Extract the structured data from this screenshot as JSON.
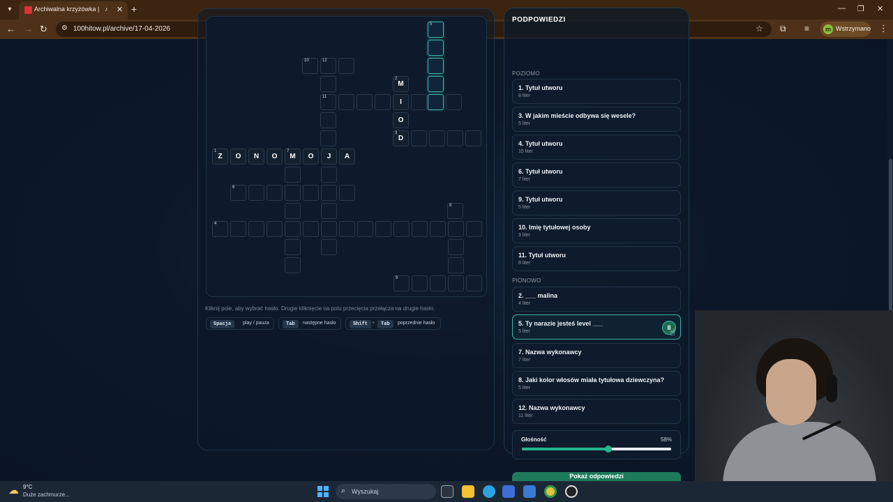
{
  "browser": {
    "tab_title": "Archiwalna krzyżówka | 100",
    "tab_audio_icon": "speaker-icon",
    "url": "100hitow.pl/archive/17-04-2026",
    "profile_initial": "m",
    "profile_label": "Wstrzymano"
  },
  "crossword": {
    "letters": {
      "r2c9": "M",
      "r3c9": "I",
      "r4c9": "O",
      "r5c9": "D",
      "r6c0": "Z",
      "r6c1": "O",
      "r6c2": "N",
      "r6c3": "O",
      "r6c4": "M",
      "r6c5": "O",
      "r6c6": "J",
      "r6c7": "A"
    },
    "numbers": {
      "n1": "1",
      "n2": "2",
      "n3": "3",
      "n4": "4",
      "n5": "5",
      "n6": "6",
      "n7": "7",
      "n8": "8",
      "n9": "9",
      "n10": "10",
      "n11": "11",
      "n12": "12"
    },
    "instructions": "Kliknij pole, aby wybrać hasło. Drugie kliknięcie na polu przecięcia przełącza na drugie hasło.",
    "shortcuts": {
      "space_key": "Spacja",
      "space_desc": "play / pauza",
      "tab_key": "Tab",
      "tab_desc": "następne hasło",
      "shift_key": "Shift",
      "plus": "+",
      "shift_tab_key": "Tab",
      "shift_tab_desc": "poprzednie hasło"
    }
  },
  "clues": {
    "title": "PODPOWIEDZI",
    "across_label": "POZIOMO",
    "down_label": "PIONOWO",
    "across": [
      {
        "text": "1. Tytuł utworu",
        "len": "8 liter"
      },
      {
        "text": "3. W jakim mieście odbywa się wesele?",
        "len": "5 liter"
      },
      {
        "text": "4. Tytuł utworu",
        "len": "15 liter"
      },
      {
        "text": "6. Tytuł utworu",
        "len": "7 liter"
      },
      {
        "text": "9. Tytuł utworu",
        "len": "5 liter"
      },
      {
        "text": "10. Imię tytułowej osoby",
        "len": "3 liter"
      },
      {
        "text": "11. Tytuł utworu",
        "len": "8 liter"
      }
    ],
    "down": [
      {
        "text": "2. ___ malina",
        "len": "4 liter"
      },
      {
        "text": "5. Ty narazie jesteś level ___",
        "len": "5 liter"
      },
      {
        "text": "7. Nazwa wykonawcy",
        "len": "7 liter"
      },
      {
        "text": "8. Jaki kolor włosów miała tytułowa dziewczyna?",
        "len": "5 liter"
      },
      {
        "text": "12. Nazwa wykonawcy",
        "len": "11 liter"
      }
    ],
    "pause_glyph": "II",
    "volume_label": "Głośność",
    "volume_value": "58%",
    "volume_fraction": 0.58,
    "reveal_label": "Pokaż odpowiedzi"
  },
  "taskbar": {
    "weather_temp": "9°C",
    "weather_desc": "Duże zachmurze...",
    "search_placeholder": "Wyszukaj"
  }
}
